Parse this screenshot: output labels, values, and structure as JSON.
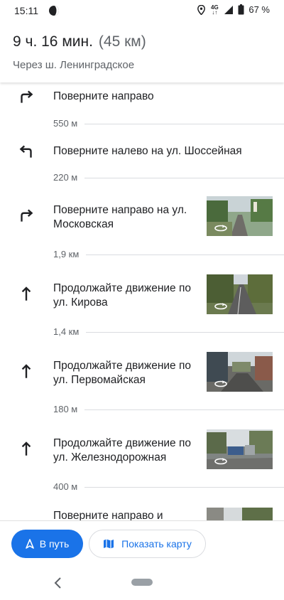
{
  "status_bar": {
    "time": "15:11",
    "network": "4G",
    "battery": "67 %"
  },
  "header": {
    "duration": "9 ч. 16 мин.",
    "distance": "(45 км)",
    "via": "Через ш. Ленинградское"
  },
  "steps": [
    {
      "instruction": "Поверните направо",
      "icon": "turn-right-icon",
      "distance_after": "550 м"
    },
    {
      "instruction": "Поверните налево на ул. Шоссейная",
      "icon": "turn-left-icon",
      "distance_after": "220 м"
    },
    {
      "instruction": "Поверните направо на ул. Московская",
      "icon": "turn-right-icon",
      "distance_after": "1,9 км"
    },
    {
      "instruction": "Продолжайте движение по ул. Кирова",
      "icon": "straight-arrow-icon",
      "distance_after": "1,4 км"
    },
    {
      "instruction": "Продолжайте движение по ул. Первомайская",
      "icon": "straight-arrow-icon",
      "distance_after": "180 м"
    },
    {
      "instruction": "Продолжайте движение по ул. Железнодорожная",
      "icon": "straight-arrow-icon",
      "distance_after": "400 м"
    },
    {
      "instruction": "Поверните направо и",
      "icon": "turn-right-icon"
    }
  ],
  "actions": {
    "start_label": "В путь",
    "show_map_label": "Показать карту"
  },
  "colors": {
    "accent": "#1a73e8",
    "text_primary": "#202124",
    "text_secondary": "#5f6368"
  }
}
